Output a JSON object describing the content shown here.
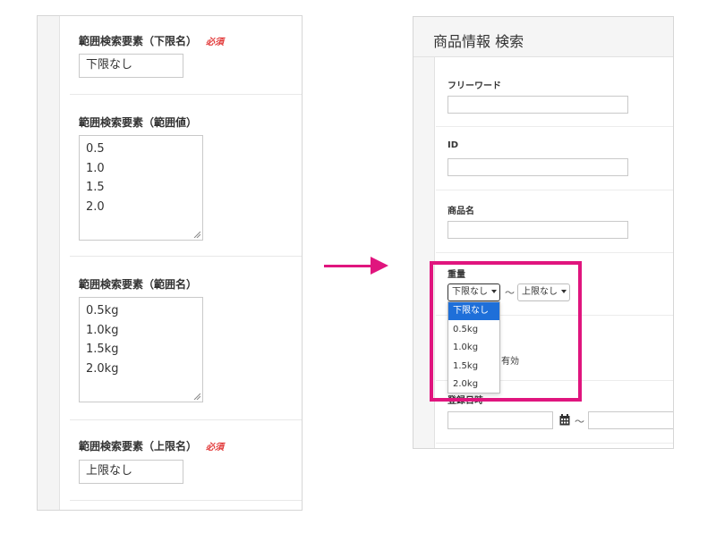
{
  "left_panel": {
    "fields": [
      {
        "title": "範囲検索要素（下限名）",
        "required": "必須",
        "value": "下限なし"
      },
      {
        "title": "範囲検索要素（範囲値）",
        "lines": [
          "0.5",
          "1.0",
          "1.5",
          "2.0"
        ]
      },
      {
        "title": "範囲検索要素（範囲名）",
        "lines": [
          "0.5kg",
          "1.0kg",
          "1.5kg",
          "2.0kg"
        ]
      },
      {
        "title": "範囲検索要素（上限名）",
        "required": "必須",
        "value": "上限なし"
      }
    ]
  },
  "right_panel": {
    "title": "商品情報 検索",
    "fields": [
      {
        "label": "フリーワード"
      },
      {
        "label": "ID"
      },
      {
        "label": "商品名"
      }
    ],
    "weight": {
      "label": "重量",
      "lower_select": "下限なし",
      "tilde": "〜",
      "upper_select": "上限なし",
      "options": [
        "下限なし",
        "0.5kg",
        "1.0kg",
        "1.5kg",
        "2.0kg"
      ],
      "selected_option": "下限なし"
    },
    "partial_text": "有効",
    "date": {
      "label": "登録日時",
      "tilde": "〜"
    }
  },
  "colors": {
    "accent": "#e0157e",
    "required": "#e23a3a",
    "selected_option_bg": "#1e6fd9"
  }
}
